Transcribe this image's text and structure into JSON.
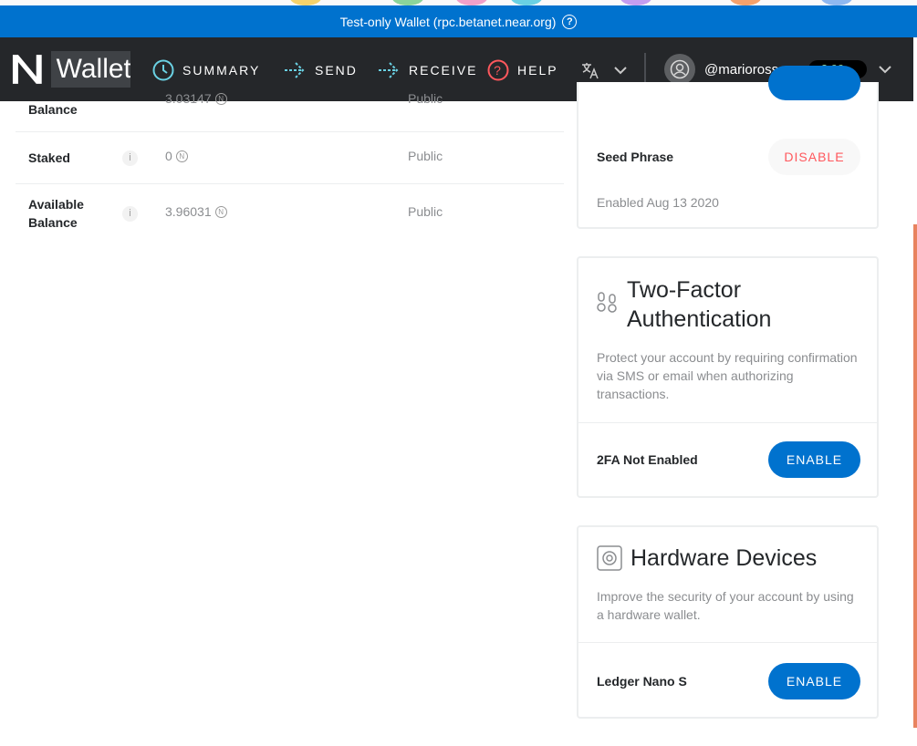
{
  "banner": {
    "text": "Test-only Wallet (rpc.betanet.near.org)",
    "help_icon": "question-circle-icon",
    "background": "#0072ce"
  },
  "navbar": {
    "logo_text": "Wallet",
    "items": [
      {
        "label": "SUMMARY",
        "icon": "clock-icon",
        "color": "#6ad1e3"
      },
      {
        "label": "SEND",
        "icon": "send-arrow-icon",
        "color": "#6ad1e3"
      },
      {
        "label": "RECEIVE",
        "icon": "receive-arrow-icon",
        "color": "#6ad1e3"
      },
      {
        "label": "HELP",
        "icon": "help-icon",
        "color": "#ff585d"
      }
    ],
    "language_icon": "translate-icon",
    "account": {
      "name": "@marioross...",
      "balance": "3.99..."
    },
    "background": "#25272a"
  },
  "balances": [
    {
      "label_line1": "",
      "label_line2": "Balance",
      "amount": "3.03147",
      "visibility": "Public"
    },
    {
      "label_line1": "Staked",
      "label_line2": "",
      "amount": "0",
      "visibility": "Public"
    },
    {
      "label_line1": "Available",
      "label_line2": "Balance",
      "amount": "3.96031",
      "visibility": "Public"
    }
  ],
  "recovery_card": {
    "method_label": "Seed Phrase",
    "disable_label": "DISABLE",
    "enabled_text": "Enabled Aug 13 2020"
  },
  "twofa_card": {
    "title_line1": "Two-Factor",
    "title_line2": "Authentication",
    "description": "Protect your account by requiring confirmation via SMS or email when authorizing transactions.",
    "status": "2FA Not Enabled",
    "enable_label": "ENABLE"
  },
  "hardware_card": {
    "title": "Hardware Devices",
    "description": "Improve the security of your account by using a hardware wallet.",
    "device": "Ledger Nano S",
    "enable_label": "ENABLE"
  },
  "colors": {
    "accent_blue": "#0072ce",
    "danger_red": "#ff585d",
    "text_muted": "#8b8d90"
  }
}
